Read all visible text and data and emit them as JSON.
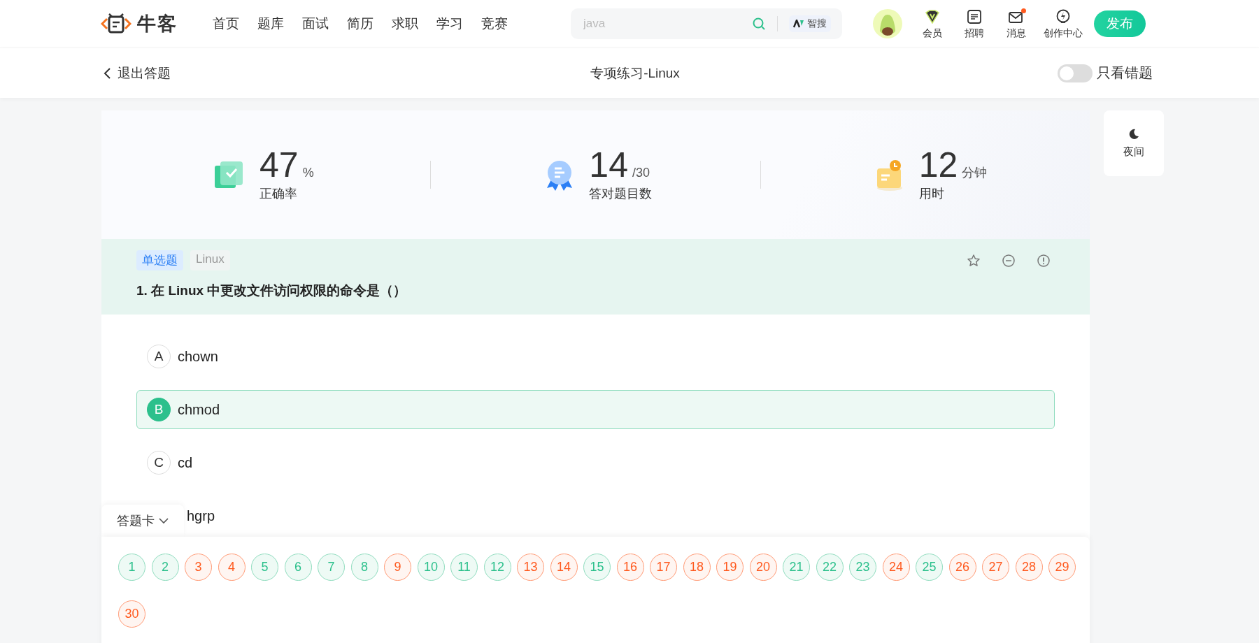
{
  "header": {
    "logo": "牛客",
    "nav": [
      {
        "label": "首页",
        "selected": false
      },
      {
        "label": "题库",
        "selected": false
      },
      {
        "label": "面试",
        "selected": false
      },
      {
        "label": "简历",
        "selected": false
      },
      {
        "label": "求职",
        "selected": false
      },
      {
        "label": "学习",
        "selected": false
      },
      {
        "label": "竞赛",
        "selected": false
      }
    ],
    "search": {
      "placeholder": "java",
      "ai_label": "智搜"
    },
    "actions": [
      {
        "kind": "vip",
        "label": "会员",
        "badge": false
      },
      {
        "kind": "jobs",
        "label": "招聘",
        "badge": false
      },
      {
        "kind": "mail",
        "label": "消息",
        "badge": true
      },
      {
        "kind": "create",
        "label": "创作中心",
        "badge": false
      }
    ],
    "publish": "发布"
  },
  "subheader": {
    "back": "退出答题",
    "title": "专项练习-Linux",
    "wrong_only": {
      "label": "只看错题",
      "on": false
    }
  },
  "stats": [
    {
      "kind": "accuracy",
      "value": "47",
      "unit": "%",
      "label": "正确率"
    },
    {
      "kind": "correct",
      "value": "14",
      "unit": "/30",
      "label": "答对题目数"
    },
    {
      "kind": "time",
      "value": "12",
      "unit": "分钟",
      "label": "用时"
    }
  ],
  "night": {
    "label": "夜间"
  },
  "question": {
    "tags": [
      {
        "kind": "type",
        "text": "单选题"
      },
      {
        "kind": "subject",
        "text": "Linux"
      }
    ],
    "number": "1.",
    "text": "在 Linux 中更改文件访问权限的命令是（）",
    "options": [
      {
        "label": "A",
        "text": "chown",
        "selected": false
      },
      {
        "label": "B",
        "text": "chmod",
        "selected": true
      },
      {
        "label": "C",
        "text": "cd",
        "selected": false
      },
      {
        "text": "hgrp",
        "selected": false
      }
    ]
  },
  "answer_card": {
    "title": "答题卡",
    "expanded": true,
    "items": [
      {
        "n": "1",
        "correct": true
      },
      {
        "n": "2",
        "correct": true
      },
      {
        "n": "3",
        "correct": false
      },
      {
        "n": "4",
        "correct": false
      },
      {
        "n": "5",
        "correct": true
      },
      {
        "n": "6",
        "correct": true
      },
      {
        "n": "7",
        "correct": true
      },
      {
        "n": "8",
        "correct": true
      },
      {
        "n": "9",
        "correct": false
      },
      {
        "n": "10",
        "correct": true
      },
      {
        "n": "11",
        "correct": true
      },
      {
        "n": "12",
        "correct": true
      },
      {
        "n": "13",
        "correct": false
      },
      {
        "n": "14",
        "correct": false
      },
      {
        "n": "15",
        "correct": true
      },
      {
        "n": "16",
        "correct": false
      },
      {
        "n": "17",
        "correct": false
      },
      {
        "n": "18",
        "correct": false
      },
      {
        "n": "19",
        "correct": false
      },
      {
        "n": "20",
        "correct": false
      },
      {
        "n": "21",
        "correct": true
      },
      {
        "n": "22",
        "correct": true
      },
      {
        "n": "23",
        "correct": true
      },
      {
        "n": "24",
        "correct": false
      },
      {
        "n": "25",
        "correct": true
      },
      {
        "n": "26",
        "correct": false
      },
      {
        "n": "27",
        "correct": false
      },
      {
        "n": "28",
        "correct": false
      },
      {
        "n": "29",
        "correct": false
      },
      {
        "n": "30",
        "correct": false
      }
    ]
  }
}
